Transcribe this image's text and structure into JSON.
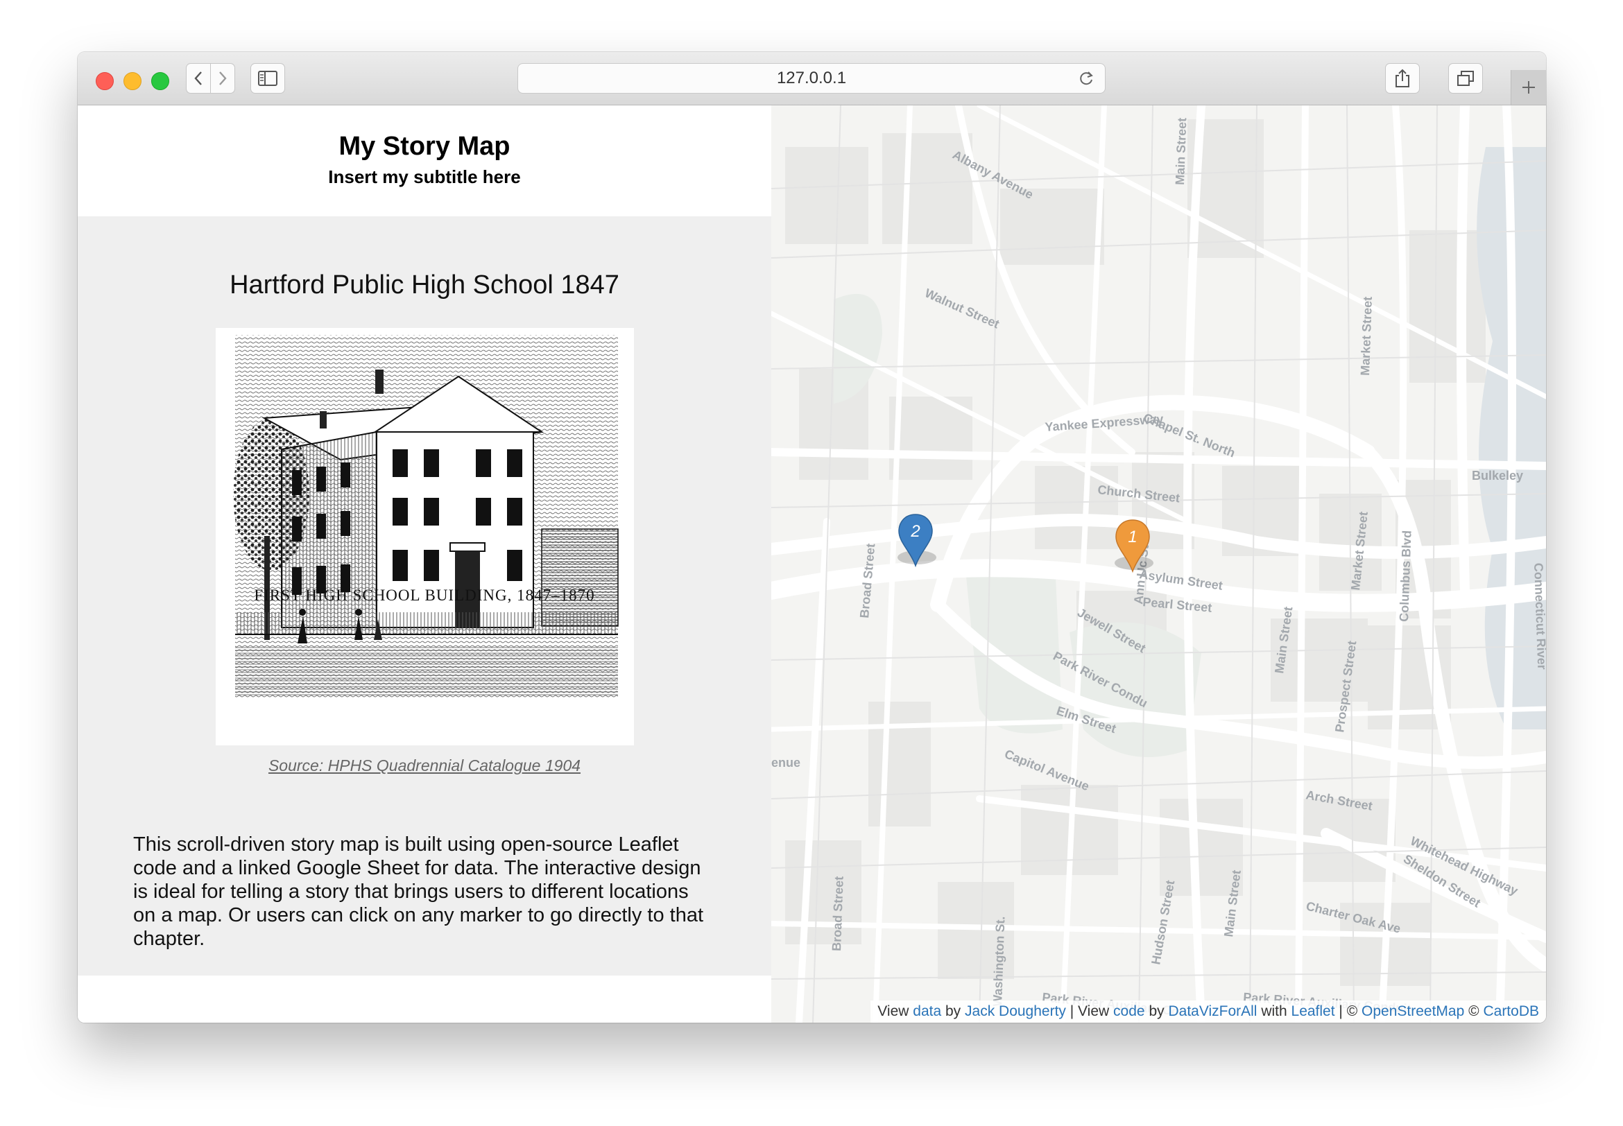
{
  "browser": {
    "url": "127.0.0.1"
  },
  "header": {
    "title": "My Story Map",
    "subtitle": "Insert my subtitle here"
  },
  "chapter": {
    "title": "Hartford Public High School 1847",
    "image_caption": "FIRST HIGH SCHOOL BUILDING, 1847–1870",
    "source_link": "Source: HPHS Quadrennial Catalogue 1904",
    "description": "This scroll-driven story map is built using open-source Leaflet code and a linked Google Sheet for data. The interactive design is ideal for telling a story that brings users to different locations on a map. Or users can click on any marker to go directly to that chapter."
  },
  "map": {
    "markers": [
      {
        "label": "1",
        "color": "#ef9a3c"
      },
      {
        "label": "2",
        "color": "#3c7fc3"
      }
    ],
    "street_labels": {
      "albany": "Albany Avenue",
      "walnut": "Walnut Street",
      "main_top": "Main Street",
      "yankee": "Yankee Expressway",
      "chapel": "Chapel St. North",
      "church": "Church Street",
      "bulkeley": "Bulkeley",
      "asylum": "Asylum Street",
      "pearl": "Pearl Street",
      "jewell": "Jewell Street",
      "broad_top": "Broad Street",
      "ann": "Ann Uc St",
      "park_river": "Park River Condu",
      "elm": "Elm Street",
      "capitol": "Capitol Avenue",
      "main_mid": "Main Street",
      "main_low": "Main Street",
      "prospect": "Prospect Street",
      "market_top": "Market Street",
      "market_mid": "Market Street",
      "columbus": "Columbus Blvd",
      "arch": "Arch Street",
      "whitehead": "Whitehead Highway",
      "sheldon": "Sheldon Street",
      "charter_oak": "Charter Oak Ave",
      "broad_low": "Broad Street",
      "washington": "Washington St.",
      "hudson": "Hudson Street",
      "aux1": "Park River Auxiliary Conc",
      "aux2": "Park River Auxiliary Conduit",
      "connecticut": "Connecticut River",
      "avenue_edge": "enue"
    },
    "attribution": {
      "view1": "View",
      "data_link": "data",
      "by1": "by",
      "author_link": "Jack Dougherty",
      "sep1": "| View",
      "code_link": "code",
      "by2": "by",
      "org_link": "DataVizForAll",
      "with": "with",
      "leaflet_link": "Leaflet",
      "sep2": "| ©",
      "osm_link": "OpenStreetMap",
      "copy2": "©",
      "carto_link": "CartoDB"
    }
  }
}
